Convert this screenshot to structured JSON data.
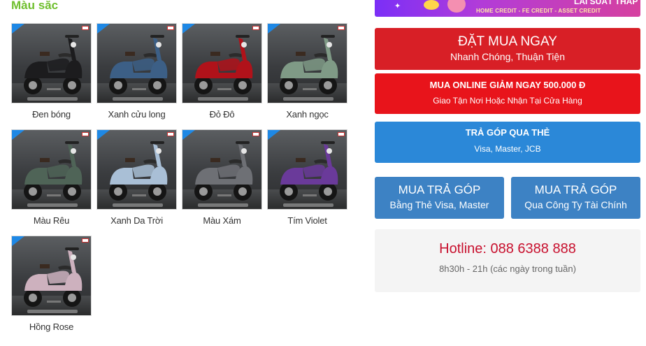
{
  "colors_section": {
    "title": "Màu sắc",
    "swatches": [
      {
        "label": "Đen bóng",
        "color": "#1c1c1e"
      },
      {
        "label": "Xanh cửu long",
        "color": "#3c5f86"
      },
      {
        "label": "Đỏ Đô",
        "color": "#b0121a"
      },
      {
        "label": "Xanh ngọc",
        "color": "#7f9a86"
      },
      {
        "label": "Màu Rêu",
        "color": "#4f6457"
      },
      {
        "label": "Xanh Da Trời",
        "color": "#a9bfd6"
      },
      {
        "label": "Màu Xám",
        "color": "#6e7075"
      },
      {
        "label": "Tím Violet",
        "color": "#6a3a9a"
      },
      {
        "label": "Hồng Rose",
        "color": "#cdb1be"
      }
    ]
  },
  "promo_banner": {
    "title": "LÃI SUẤT THẤP",
    "partners": "HOME CREDIT - FE CREDIT - ASSET CREDIT"
  },
  "actions": {
    "buy_now": {
      "main": "ĐẶT MUA NGAY",
      "sub": "Nhanh Chóng, Thuận Tiện"
    },
    "online": {
      "main": "MUA ONLINE GIẢM NGAY 500.000 Đ",
      "sub": "Giao Tận Nơi Hoặc Nhận Tại Cửa Hàng"
    },
    "card_installment": {
      "main": "TRẢ GÓP QUA THẺ",
      "sub": "Visa, Master, JCB"
    },
    "installment_visa": {
      "main": "MUA TRẢ GÓP",
      "sub": "Bằng Thẻ Visa, Master"
    },
    "installment_company": {
      "main": "MUA TRẢ GÓP",
      "sub": "Qua Công Ty Tài Chính"
    }
  },
  "hotline": {
    "phone": "Hotline: 088 6388 888",
    "hours": "8h30h - 21h (các ngày trong tuần)"
  },
  "theme": {
    "title_green": "#6fbf2e",
    "cta_red": "#d81f26",
    "cta_blue": "#2b88d8",
    "hotline_red": "#c8102e"
  }
}
